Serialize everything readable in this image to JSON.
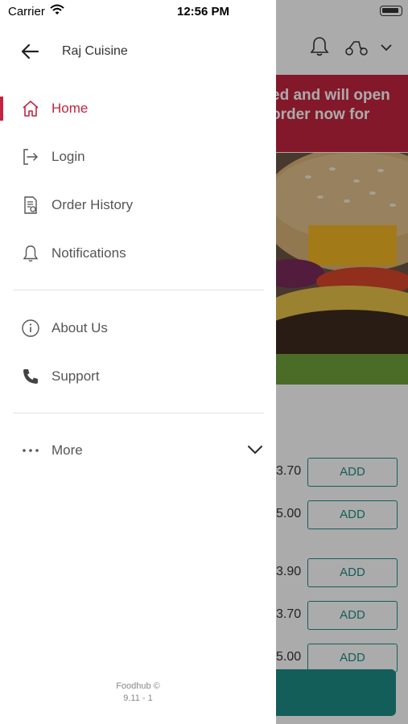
{
  "status_bar": {
    "carrier": "Carrier",
    "time": "12:56 PM"
  },
  "drawer": {
    "restaurant_name": "Raj Cuisine",
    "items": [
      {
        "label": "Home",
        "icon": "home-icon",
        "active": true
      },
      {
        "label": "Login",
        "icon": "login-icon"
      },
      {
        "label": "Order History",
        "icon": "order-history-icon"
      },
      {
        "label": "Notifications",
        "icon": "bell-icon"
      },
      {
        "label": "About Us",
        "icon": "info-icon"
      },
      {
        "label": "Support",
        "icon": "phone-icon"
      },
      {
        "label": "More",
        "icon": "more-dots-icon"
      }
    ],
    "footer": {
      "brand": "Foodhub ©",
      "version": "9.11 - 1"
    }
  },
  "background": {
    "banner_lines": [
      "ed and will open",
      "order now for"
    ],
    "items": [
      {
        "price": "3.70",
        "add_label": "ADD"
      },
      {
        "price": "5.00",
        "add_label": "ADD"
      },
      {
        "price": "3.90",
        "add_label": "ADD"
      },
      {
        "price": "3.70",
        "add_label": "ADD"
      },
      {
        "price": "5.00",
        "add_label": "ADD"
      }
    ]
  },
  "colors": {
    "accent": "#c4243f",
    "teal": "#1e8c86",
    "text": "#555555"
  }
}
